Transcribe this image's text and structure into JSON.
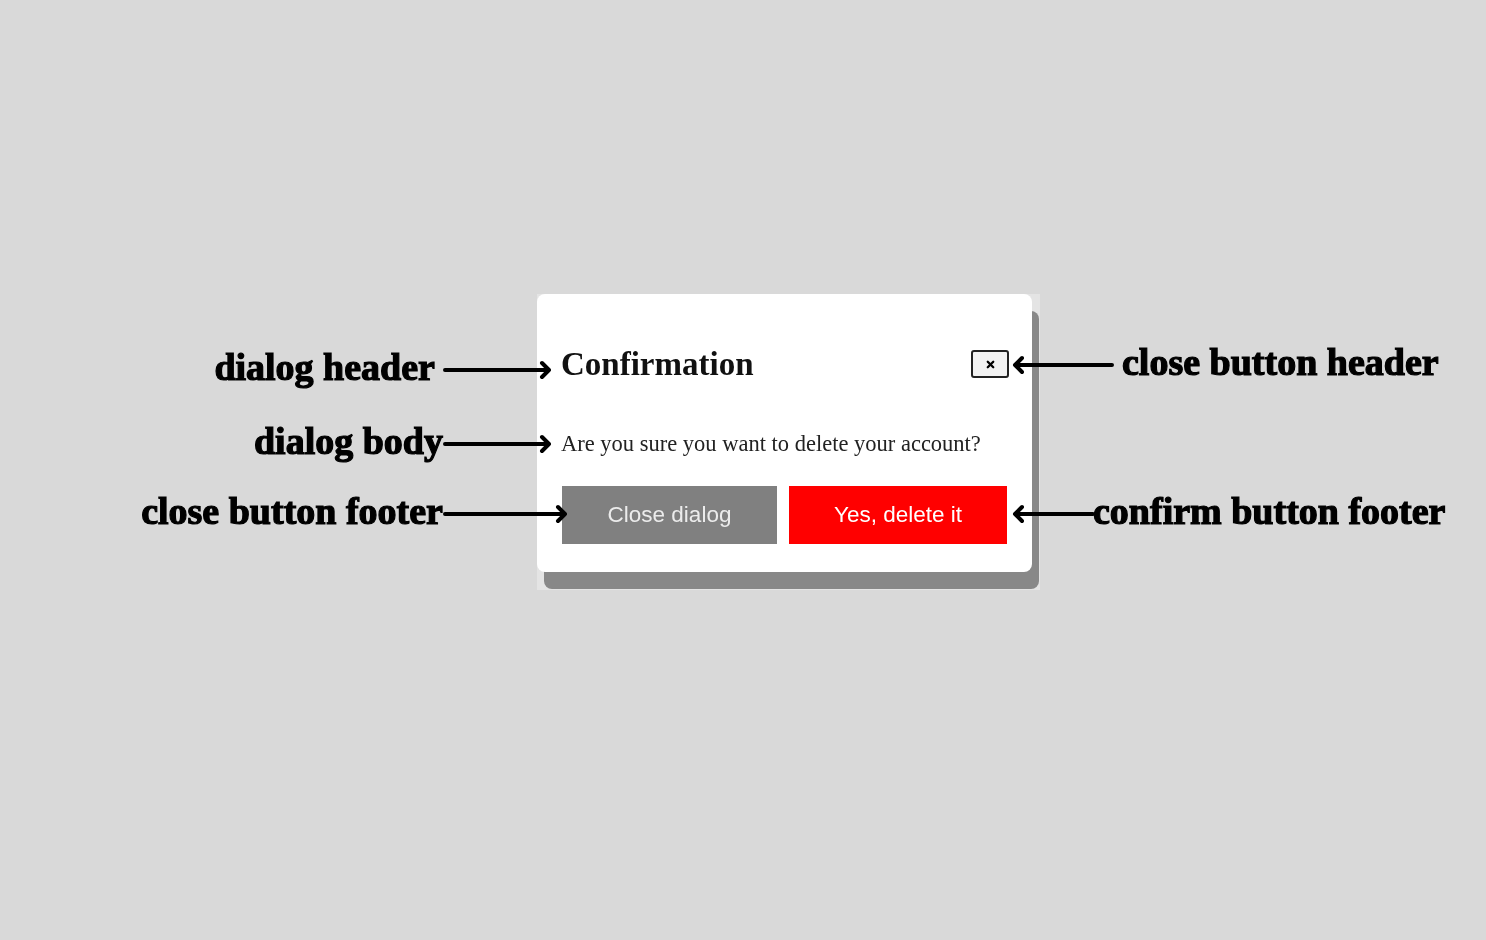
{
  "dialog": {
    "title": "Confirmation",
    "body": "Are you sure you want to delete your account?",
    "buttons": [
      {
        "label": "Close dialog",
        "kind": "secondary"
      },
      {
        "label": "Yes, delete it",
        "kind": "danger"
      }
    ]
  },
  "annotations": [
    {
      "label": "dialog header",
      "kind": "left"
    },
    {
      "label": "dialog body",
      "kind": "left"
    },
    {
      "label": "close button footer",
      "kind": "left"
    },
    {
      "label": "close button header",
      "kind": "right"
    },
    {
      "label": "confirm button footer",
      "kind": "right"
    }
  ]
}
